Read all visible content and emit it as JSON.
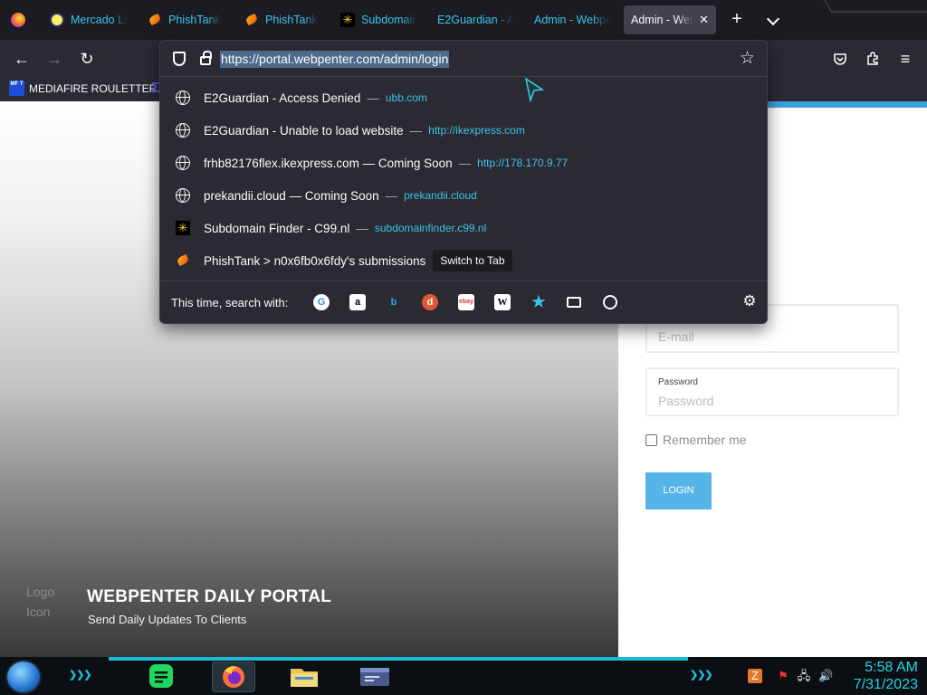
{
  "browser": {
    "tabs": [
      {
        "label": "Mercado Li",
        "icon": "mercado-icon"
      },
      {
        "label": "PhishTank",
        "icon": "phishtank-icon"
      },
      {
        "label": "PhishTank",
        "icon": "phishtank-icon"
      },
      {
        "label": "Subdomain",
        "icon": "c99-icon"
      },
      {
        "label": "E2Guardian - Ac",
        "icon": "none"
      },
      {
        "label": "Admin - Webpe",
        "icon": "none"
      },
      {
        "label": "Admin - Web",
        "icon": "none",
        "active": true
      }
    ],
    "close_glyph": "✕",
    "new_tab_glyph": "+",
    "nav": {
      "back": "←",
      "forward": "→",
      "reload": "↻"
    },
    "bookmarks": [
      {
        "label": "MEDIAFIRE ROULETTER",
        "badge": "MF T"
      }
    ],
    "menu_glyph": "≡"
  },
  "url_popup": {
    "url": "https://portal.webpenter.com/admin/login",
    "suggestions": [
      {
        "title": "E2Guardian - Access Denied",
        "url": "ubb.com",
        "icon": "globe-icon"
      },
      {
        "title": "E2Guardian - Unable to load website",
        "url": "http://ikexpress.com",
        "icon": "globe-icon"
      },
      {
        "title": "frhb82176flex.ikexpress.com — Coming Soon",
        "url": "http://178.170.9.77",
        "icon": "globe-icon"
      },
      {
        "title": "prekandii.cloud — Coming Soon",
        "url": "prekandii.cloud",
        "icon": "globe-icon"
      },
      {
        "title": "Subdomain Finder - C99.nl",
        "url": "subdomainfinder.c99.nl",
        "icon": "c99-icon"
      },
      {
        "title": "PhishTank > n0x6fb0x6fdy's submissions",
        "action": "Switch to Tab",
        "icon": "phishtank-icon"
      }
    ],
    "dash": "—",
    "search_with_label": "This time, search with:",
    "engines": [
      "google",
      "amazon",
      "bing",
      "duckduckgo",
      "ebay",
      "wikipedia",
      "bookmarks",
      "tabs",
      "history"
    ]
  },
  "page": {
    "logo_placeholder": "Logo Icon",
    "title": "WEBPENTER DAILY PORTAL",
    "subtitle": "Send Daily Updates To Clients",
    "email_placeholder": "E-mail",
    "password_label": "Password",
    "password_placeholder": "Password",
    "remember_label": "Remember me",
    "login_label": "LOGIN",
    "accent_color": "#3ea0db"
  },
  "taskbar": {
    "time": "5:58 AM",
    "date": "7/31/2023",
    "chevrons": "❯❯❯",
    "apps": [
      "notes-app",
      "firefox",
      "file-manager",
      "window-app"
    ]
  }
}
